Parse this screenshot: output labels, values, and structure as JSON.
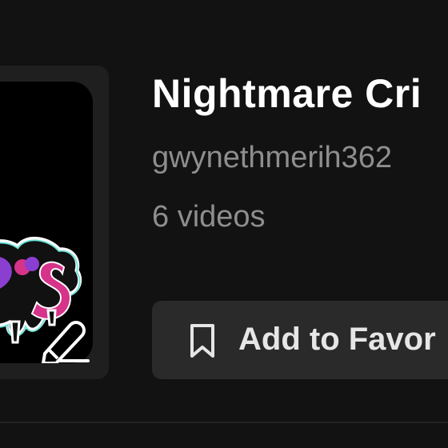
{
  "playlist": {
    "title": "Nightmare Cri",
    "author": "gwynethmerih362",
    "video_count": "6 videos",
    "thumbnail_icon": "edit-pencil-icon"
  },
  "actions": {
    "favorite_label": "Add to Favor",
    "favorite_icon": "bookmark-icon"
  },
  "colors": {
    "background": "#121212",
    "button_bg": "#2a2a2a",
    "muted_text": "#8e8e8e",
    "thumb_pink": "#d6338a",
    "thumb_purple": "#8a3fd1"
  }
}
